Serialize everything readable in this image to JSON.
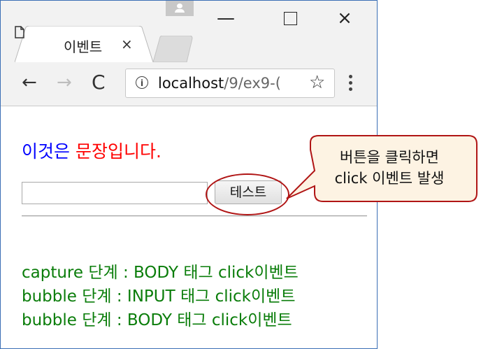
{
  "browser": {
    "tab_title": "이벤트",
    "tab_close": "×",
    "url_host": "localhost",
    "url_path": "/9/ex9-(",
    "info_icon": "i",
    "window_controls": {
      "minimize": "—",
      "close": "×"
    },
    "nav_icons": {
      "back": "←",
      "forward": "→",
      "reload": "C"
    },
    "star_icon": "☆"
  },
  "page": {
    "sentence_blue": "이것은",
    "sentence_red": "문장입니다.",
    "input_value": "",
    "button_label": "테스트",
    "log": [
      "capture 단계 : BODY 태그 click이벤트",
      "bubble 단계 : INPUT 태그 click이벤트",
      "bubble 단계 : BODY 태그 click이벤트"
    ]
  },
  "annotation": {
    "line1": "버튼을 클릭하면",
    "line2": "click 이벤트 발생"
  },
  "colors": {
    "accent_blue": "#0000ff",
    "accent_red": "#ff0000",
    "log_green": "#0a7d0a",
    "callout_fill": "#fdf3e3",
    "callout_border": "#b01515"
  }
}
